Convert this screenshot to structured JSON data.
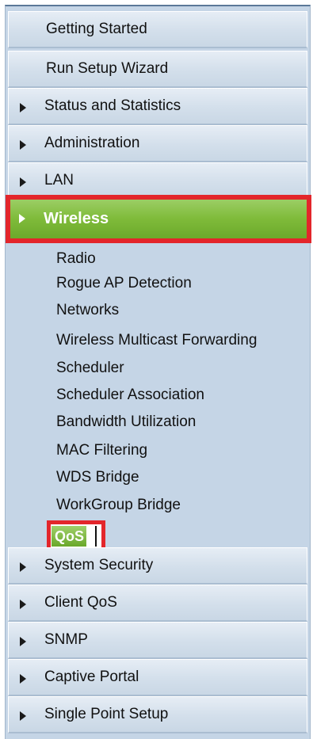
{
  "nav": {
    "top_items": [
      {
        "label": "Getting Started"
      },
      {
        "label": "Run Setup Wizard"
      },
      {
        "label": "Status and Statistics"
      },
      {
        "label": "Administration"
      },
      {
        "label": "LAN"
      }
    ],
    "active_item": {
      "label": "Wireless"
    },
    "wireless_sub": [
      "Radio",
      "Rogue AP Detection",
      "Networks",
      "Wireless Multicast Forwarding",
      "Scheduler",
      "Scheduler Association",
      "Bandwidth Utilization",
      "MAC Filtering",
      "WDS Bridge",
      "WorkGroup Bridge"
    ],
    "selected_sub": "QoS",
    "bottom_items": [
      {
        "label": "System Security"
      },
      {
        "label": "Client QoS"
      },
      {
        "label": "SNMP"
      },
      {
        "label": "Captive Portal"
      },
      {
        "label": "Single Point Setup"
      }
    ]
  },
  "colors": {
    "panel_bg": "#c5d5e6",
    "active_green": "#7fbb3a",
    "highlight_red": "#e3262b"
  },
  "icons": {
    "expand": "triangle-right-icon"
  }
}
